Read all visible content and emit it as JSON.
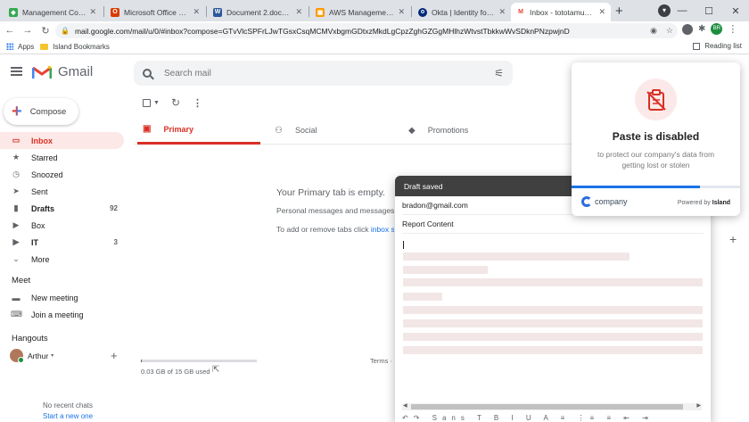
{
  "browser": {
    "tabs": [
      {
        "title": "Management Console | ...",
        "favicon_color": "#34a853",
        "favicon_glyph": "◆"
      },
      {
        "title": "Microsoft Office Home",
        "favicon_color": "#d83b01",
        "favicon_glyph": "O"
      },
      {
        "title": "Document 2.docx - Mic...",
        "favicon_color": "#2b579a",
        "favicon_glyph": "W"
      },
      {
        "title": "AWS Management Cons...",
        "favicon_color": "#ff9900",
        "favicon_glyph": "▣"
      },
      {
        "title": "Okta | Identity for the In...",
        "favicon_color": "#00297a",
        "favicon_glyph": "o"
      },
      {
        "title": "Inbox - tototamus112@...",
        "favicon_color": "#ea4335",
        "favicon_glyph": "M",
        "active": true
      }
    ],
    "new_tab_icon": "plus-icon",
    "url": "mail.google.com/mail/u/0/#inbox?compose=GTvVlcSPFrLJwTGsxCsqMCMVxbgmGDtxzMkdLgCpzZghGZGgMHlhzWtvstTbkkwWvSDknPNzpwjnD",
    "bookmarks": {
      "apps": "Apps",
      "folder": "Island Bookmarks",
      "reading_list": "Reading list"
    },
    "avatar_initials": "BR",
    "avatar_color": "#1e8e3e"
  },
  "gmail": {
    "logo_text": "Gmail",
    "search_placeholder": "Search mail",
    "compose_label": "Compose",
    "nav": [
      {
        "label": "Inbox",
        "icon": "inbox-icon",
        "glyph": "▭",
        "active": true
      },
      {
        "label": "Starred",
        "icon": "star-icon",
        "glyph": "★"
      },
      {
        "label": "Snoozed",
        "icon": "clock-icon",
        "glyph": "◷"
      },
      {
        "label": "Sent",
        "icon": "send-icon",
        "glyph": "➤"
      },
      {
        "label": "Drafts",
        "icon": "draft-icon",
        "glyph": "▮",
        "count": "92",
        "bold": true
      },
      {
        "label": "Box",
        "icon": "label-icon",
        "glyph": "▶"
      },
      {
        "label": "IT",
        "icon": "label-icon",
        "glyph": "▶",
        "count": "3",
        "bold": true
      },
      {
        "label": "More",
        "icon": "chevron-down-icon",
        "glyph": "⌄"
      }
    ],
    "meet": {
      "title": "Meet",
      "items": [
        {
          "label": "New meeting",
          "icon": "video-icon",
          "glyph": "▬"
        },
        {
          "label": "Join a meeting",
          "icon": "keyboard-icon",
          "glyph": "⌨"
        }
      ]
    },
    "hangouts": {
      "title": "Hangouts",
      "user": "Arthur",
      "no_chats": "No recent chats",
      "start_chat": "Start a new one"
    },
    "categories": [
      {
        "label": "Primary",
        "icon": "inbox-icon",
        "glyph": "▣",
        "active": true
      },
      {
        "label": "Social",
        "icon": "people-icon",
        "glyph": "👥"
      },
      {
        "label": "Promotions",
        "icon": "tag-icon",
        "glyph": "◆"
      }
    ],
    "empty": {
      "title": "Your Primary tab is empty.",
      "desc": "Personal messages and messages t",
      "add_prefix": "To add or remove tabs click ",
      "add_link": "inbox se"
    },
    "storage": {
      "text": "0.03 GB of 15 GB used",
      "used_fraction": 0.002
    },
    "terms": "Terms ·"
  },
  "compose_window": {
    "header": "Draft saved",
    "to": "bradon@gmail.com",
    "subject": "Report Content"
  },
  "popup": {
    "title": "Paste is disabled",
    "desc": "to protect our company's data from getting lost or stolen",
    "brand": "company",
    "powered_prefix": "Powered by ",
    "powered_brand": "Island",
    "progress_fraction": 0.76,
    "icon": "clipboard-blocked-icon",
    "accent": "#d93025"
  }
}
